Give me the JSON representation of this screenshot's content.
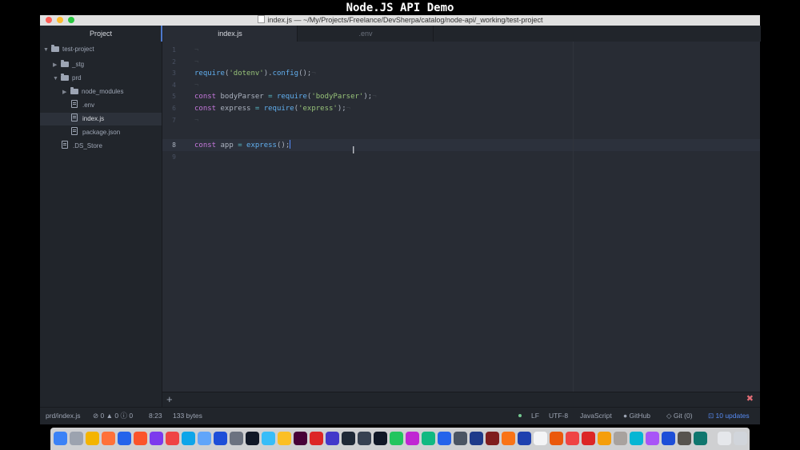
{
  "video_caption": "Node.JS API Demo",
  "window": {
    "title": "index.js — ~/My/Projects/Freelance/DevSherpa/catalog/node-api/_working/test-project"
  },
  "tabs": {
    "project_label": "Project",
    "editor_tabs": [
      {
        "label": "index.js",
        "active": true
      },
      {
        "label": ".env",
        "active": false
      }
    ]
  },
  "tree": [
    {
      "label": "test-project",
      "type": "folder",
      "expanded": true
    },
    {
      "label": "_stg",
      "type": "folder",
      "expanded": false
    },
    {
      "label": "prd",
      "type": "folder",
      "expanded": true
    },
    {
      "label": "node_modules",
      "type": "folder",
      "expanded": false
    },
    {
      "label": ".env",
      "type": "file"
    },
    {
      "label": "index.js",
      "type": "file",
      "selected": true
    },
    {
      "label": "package.json",
      "type": "file"
    },
    {
      "label": ".DS_Store",
      "type": "file"
    }
  ],
  "editor": {
    "line_numbers": [
      "1",
      "2",
      "3",
      "4",
      "5",
      "6",
      "7",
      "8",
      "9"
    ],
    "active_line": "8",
    "code": {
      "l3": {
        "fn1": "require",
        "s1": "'dotenv'",
        "fn2": "config"
      },
      "l5": {
        "kw": "const",
        "name": "bodyParser",
        "fn": "require",
        "s": "'bodyParser'"
      },
      "l6": {
        "kw": "const",
        "name": "express",
        "fn": "require",
        "s": "'express'"
      },
      "l8": {
        "kw": "const",
        "name": "app",
        "fn": "express"
      }
    }
  },
  "statusbar": {
    "file_path": "prd/index.js",
    "errors": "0",
    "warnings": "0",
    "info": "0",
    "cursor_position": "8:23",
    "file_size": "133 bytes",
    "line_ending": "LF",
    "encoding": "UTF-8",
    "grammar": "JavaScript",
    "github": "GitHub",
    "git": "Git (0)",
    "updates": "10 updates"
  },
  "colors": {
    "accent": "#4d78cc",
    "keyword": "#c678dd",
    "function": "#61afef",
    "string": "#98c379",
    "operator": "#56b6c2"
  }
}
